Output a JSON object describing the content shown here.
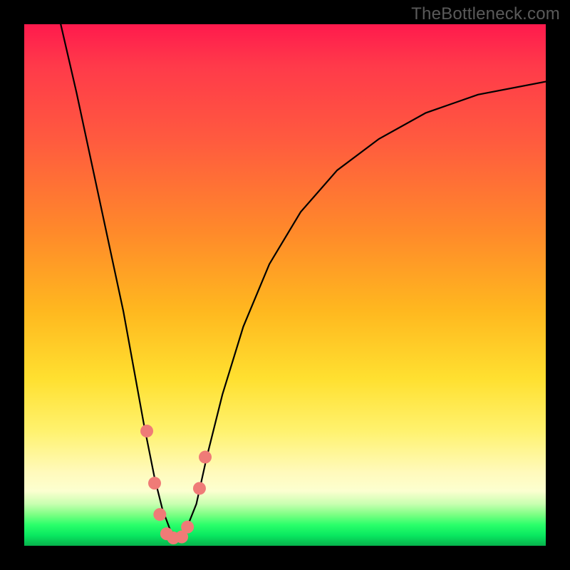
{
  "watermark": "TheBottleneck.com",
  "chart_data": {
    "type": "line",
    "title": "",
    "xlabel": "",
    "ylabel": "",
    "xlim": [
      0,
      100
    ],
    "ylim": [
      0,
      100
    ],
    "series": [
      {
        "name": "bottleneck-curve",
        "x": [
          7,
          10,
          13,
          16,
          19,
          21,
          23,
          25,
          26.5,
          28,
          29.5,
          31,
          33,
          35,
          38,
          42,
          47,
          53,
          60,
          68,
          77,
          87,
          100
        ],
        "y": [
          100,
          87,
          73,
          59,
          45,
          34,
          23,
          13,
          7,
          3,
          1.5,
          3,
          8,
          17,
          29,
          42,
          54,
          64,
          72,
          78,
          83,
          86.5,
          89
        ]
      }
    ],
    "markers": [
      {
        "x": 23.5,
        "y": 22
      },
      {
        "x": 25.0,
        "y": 12
      },
      {
        "x": 26.0,
        "y": 6
      },
      {
        "x": 27.3,
        "y": 2.3
      },
      {
        "x": 28.6,
        "y": 1.5
      },
      {
        "x": 30.2,
        "y": 1.7
      },
      {
        "x": 31.3,
        "y": 3.6
      },
      {
        "x": 33.6,
        "y": 11
      },
      {
        "x": 34.7,
        "y": 17
      }
    ],
    "colors": {
      "curve": "#000000",
      "marker": "#ef7b77",
      "gradient_top": "#ff1a4d",
      "gradient_bottom": "#07b24c"
    }
  }
}
